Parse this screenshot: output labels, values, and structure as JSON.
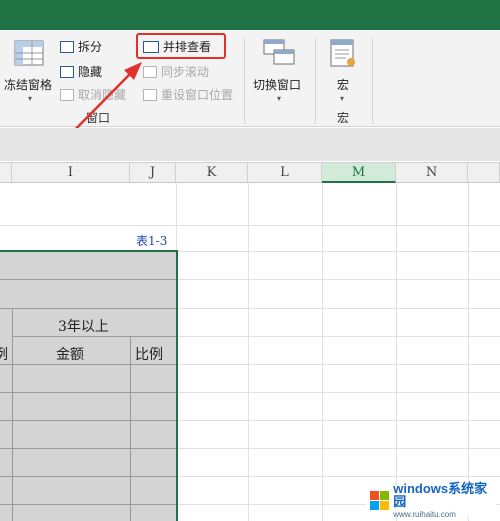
{
  "ribbon": {
    "freeze_panes": "冻结窗格",
    "split": "拆分",
    "hide": "隐藏",
    "unhide": "取消隐藏",
    "view_side_by_side": "并排查看",
    "sync_scroll": "同步滚动",
    "reset_window_position": "重设窗口位置",
    "switch_windows": "切换窗口",
    "macros": "宏",
    "group_window": "窗口",
    "group_macros": "宏"
  },
  "columns": [
    "I",
    "J",
    "K",
    "L",
    "M",
    "N"
  ],
  "active_column": "M",
  "sheet": {
    "table_ref": "表1-3",
    "header_3y": "3年以上",
    "header_amount": "金额",
    "header_ratio": "比例",
    "header_ratio_cut": "例"
  },
  "watermark": {
    "title": "windows系统家园",
    "subtitle": "www.ruihaitu.com"
  },
  "colors": {
    "excel_green": "#217346",
    "highlight_red": "#e0312c",
    "arrow_red": "#e0312c"
  }
}
